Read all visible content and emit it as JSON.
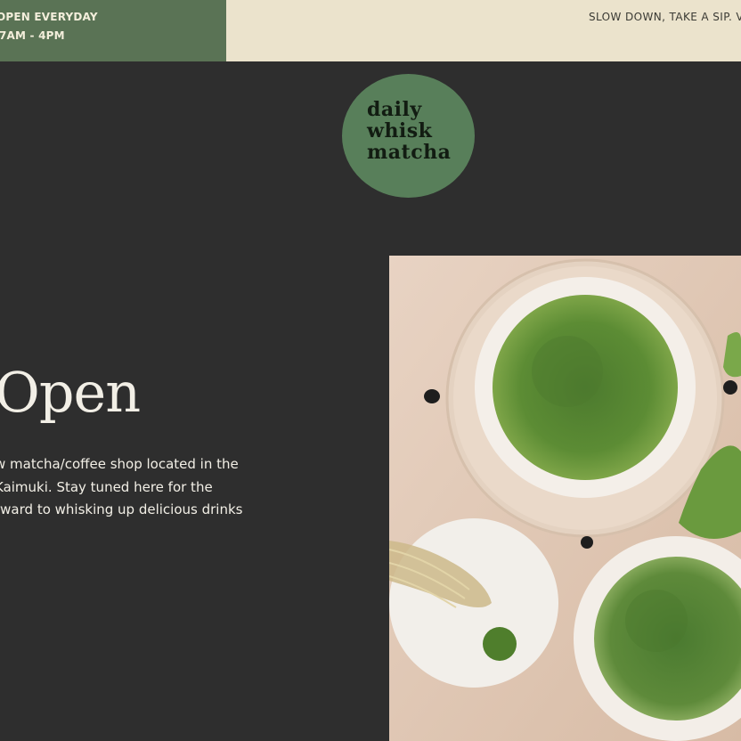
{
  "announcement_bar": {
    "hours_line1": "OPEN EVERYDAY",
    "hours_line2": "7AM - 4PM",
    "tagline": "SLOW DOWN, TAKE A SIP. V"
  },
  "logo": {
    "line1": "daily",
    "line2": "whisk",
    "line3": "matcha"
  },
  "hero": {
    "title": "Open",
    "body_line1": "w matcha/coffee shop located in the",
    "body_line2": "Kaimuki. Stay tuned here for the",
    "body_line3": "rward to whisking up delicious drinks"
  },
  "photo": {
    "icon": "matcha-bowls-photo"
  },
  "colors": {
    "background": "#2e2e2e",
    "hours_bg": "#5a7355",
    "tagline_bg": "#ebe3cc",
    "logo_bg": "#587f5a",
    "text_light": "#f2efe6"
  }
}
